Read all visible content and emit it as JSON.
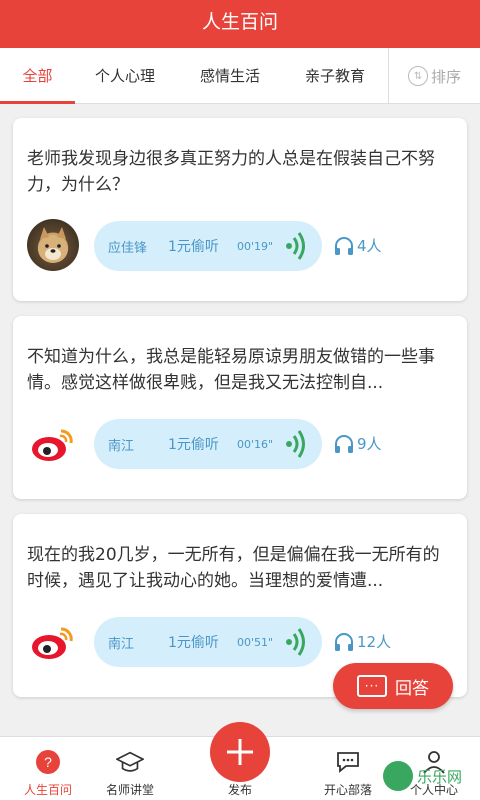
{
  "header": {
    "title": "人生百问"
  },
  "tabs": [
    {
      "label": "全部",
      "active": true
    },
    {
      "label": "个人心理",
      "active": false
    },
    {
      "label": "感情生活",
      "active": false
    },
    {
      "label": "亲子教育",
      "active": false
    }
  ],
  "sort": {
    "label": "排序",
    "icon": "sort-icon"
  },
  "cards": [
    {
      "question": "老师我发现身边很多真正努力的人总是在假装自己不努力，为什么？",
      "name": "应佳锋",
      "price": "1元偷听",
      "duration": "00'19\"",
      "listeners": "4人",
      "avatar": "dog-photo-avatar"
    },
    {
      "question": "不知道为什么，我总是能轻易原谅男朋友做错的一些事情。感觉这样做很卑贱，但是我又无法控制自...",
      "name": "南江",
      "price": "1元偷听",
      "duration": "00'16\"",
      "listeners": "9人",
      "avatar": "weibo-avatar"
    },
    {
      "question": "现在的我20几岁，一无所有，但是偏偏在我一无所有的时候，遇见了让我动心的她。当理想的爱情遭...",
      "name": "南江",
      "price": "1元偷听",
      "duration": "00'51\"",
      "listeners": "12人",
      "avatar": "weibo-avatar"
    }
  ],
  "answer_button": {
    "label": "回答"
  },
  "bottom_nav": [
    {
      "label": "人生百问",
      "icon": "question-icon",
      "active": true
    },
    {
      "label": "名师讲堂",
      "icon": "graduation-cap-icon",
      "active": false
    },
    {
      "label": "发布",
      "icon": "plus-icon",
      "active": false
    },
    {
      "label": "开心部落",
      "icon": "chat-bubble-icon",
      "active": false
    },
    {
      "label": "个人中心",
      "icon": "person-icon",
      "active": false
    }
  ],
  "watermark": {
    "text": "乐乐网"
  },
  "colors": {
    "accent": "#e8433a",
    "bubble": "#d5eefb",
    "bubble_text": "#4a97c7",
    "wave": "#3aa760"
  }
}
